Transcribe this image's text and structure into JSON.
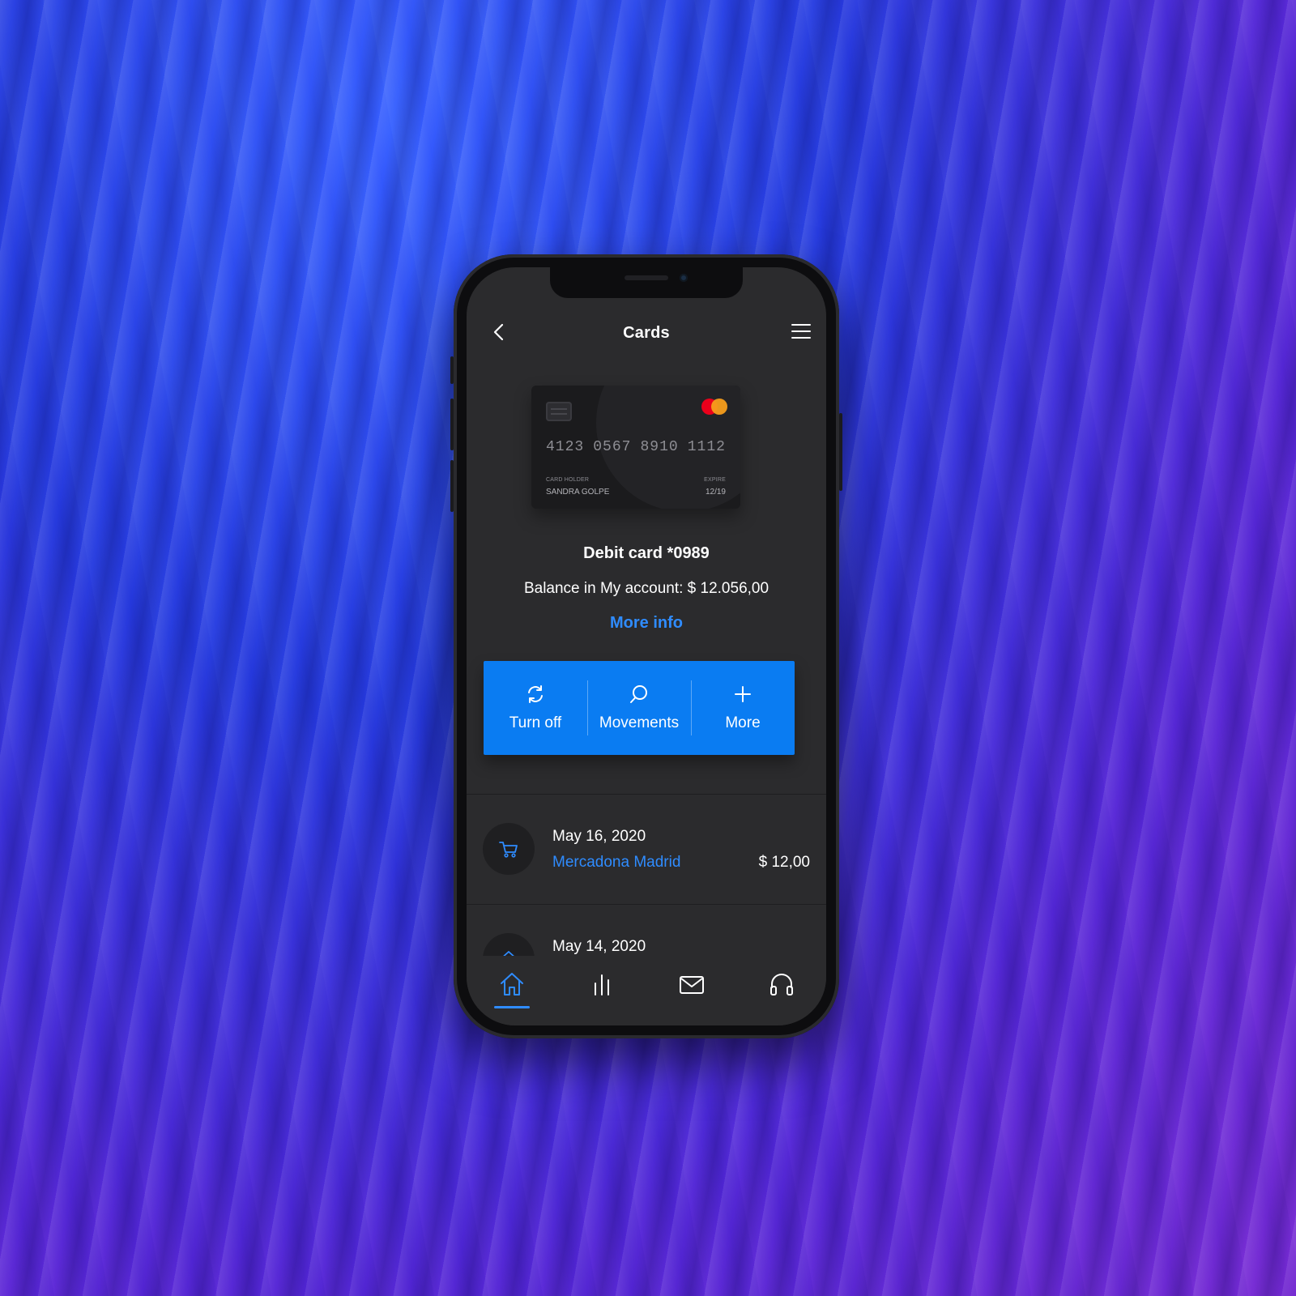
{
  "app": {
    "title": "Cards",
    "accent_color": "#2f8cff",
    "action_bar_color": "#0a7cf2"
  },
  "header": {
    "back_icon": "chevron-left-icon",
    "menu_icon": "hamburger-menu-icon"
  },
  "card": {
    "number_groups": [
      "4123",
      "0567",
      "8910",
      "1112"
    ],
    "holder_label": "CARD HOLDER",
    "holder_name": "SANDRA GOLPE",
    "expire_label": "EXPIRE",
    "expire_value": "12/19",
    "brand_icon": "mastercard-logo-icon"
  },
  "account": {
    "card_title": "Debit card *0989",
    "balance_text": "Balance in My account: $ 12.056,00",
    "more_info": "More info"
  },
  "actions": [
    {
      "label": "Turn off",
      "icon": "refresh-icon"
    },
    {
      "label": "Movements",
      "icon": "search-icon"
    },
    {
      "label": "More",
      "icon": "plus-icon"
    }
  ],
  "transactions": [
    {
      "date": "May 16, 2020",
      "merchant": "Mercadona Madrid",
      "amount": "$ 12,00",
      "icon": "shopping-cart-icon"
    },
    {
      "date": "May 14, 2020",
      "merchant": "",
      "amount": "",
      "icon": "home-icon"
    }
  ],
  "bottom_nav": [
    {
      "icon": "home-icon",
      "active": true
    },
    {
      "icon": "bar-chart-icon",
      "active": false
    },
    {
      "icon": "mail-icon",
      "active": false
    },
    {
      "icon": "headphones-icon",
      "active": false
    }
  ]
}
